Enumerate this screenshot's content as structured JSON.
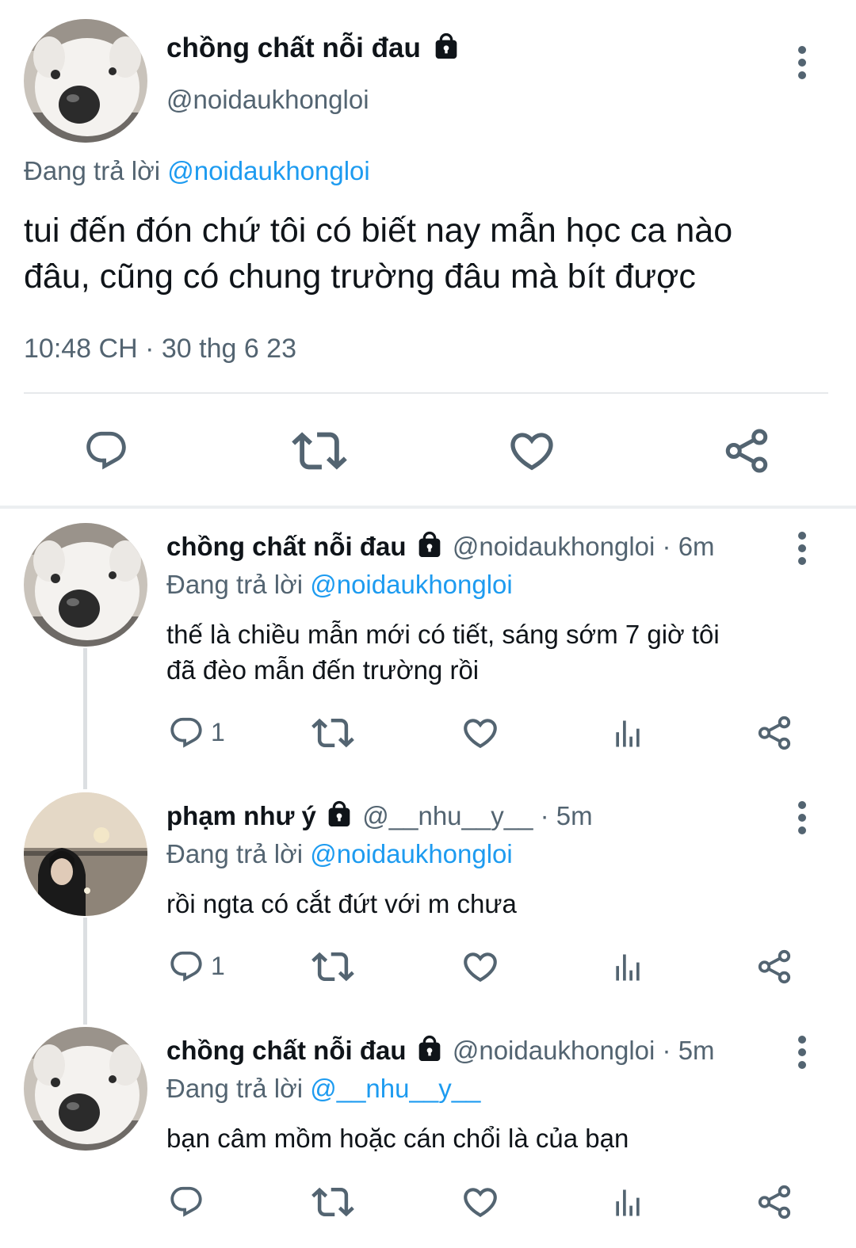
{
  "main_tweet": {
    "author_name": "chồng chất nỗi đau",
    "handle": "@noidaukhongloi",
    "replying_label": "Đang trả lời",
    "replying_to": "@noidaukhongloi",
    "text_line1": "tui đến đón chứ tôi có biết nay mẫn học ca nào",
    "text_line2": "đâu, cũng có chung trường đâu mà bít được",
    "timestamp": "10:48 CH · 30 thg 6 23",
    "action_icons": [
      "reply-icon",
      "retweet-icon",
      "like-icon",
      "share-icon"
    ]
  },
  "replies": [
    {
      "author_name": "chồng chất nỗi đau",
      "handle_time": "@noidaukhongloi · 6m",
      "replying_label": "Đang trả lời",
      "replying_to": "@noidaukhongloi",
      "text_line1": "thế là chiều mẫn mới có tiết, sáng sớm 7 giờ tôi",
      "text_line2": "đã đèo mẫn đến trường rồi",
      "reply_count": "1"
    },
    {
      "author_name": "phạm như ý",
      "handle_time": "@__nhu__y__ · 5m",
      "replying_label": "Đang trả lời",
      "replying_to": "@noidaukhongloi",
      "text_line1": "rồi ngta có cắt đứt với m chưa",
      "reply_count": "1"
    },
    {
      "author_name": "chồng chất nỗi đau",
      "handle_time": "@noidaukhongloi · 5m",
      "replying_label": "Đang trả lời",
      "replying_to": "@__nhu__y__",
      "text_line1": "bạn câm mồm hoặc cán chổi là của bạn",
      "reply_count": ""
    }
  ],
  "reply_action_icons": [
    "reply-icon",
    "retweet-icon",
    "like-icon",
    "views-icon",
    "share-icon"
  ],
  "colors": {
    "text": "#0f1419",
    "secondary": "#536471",
    "link": "#1d9bf0",
    "divider": "#dcdfe2"
  }
}
